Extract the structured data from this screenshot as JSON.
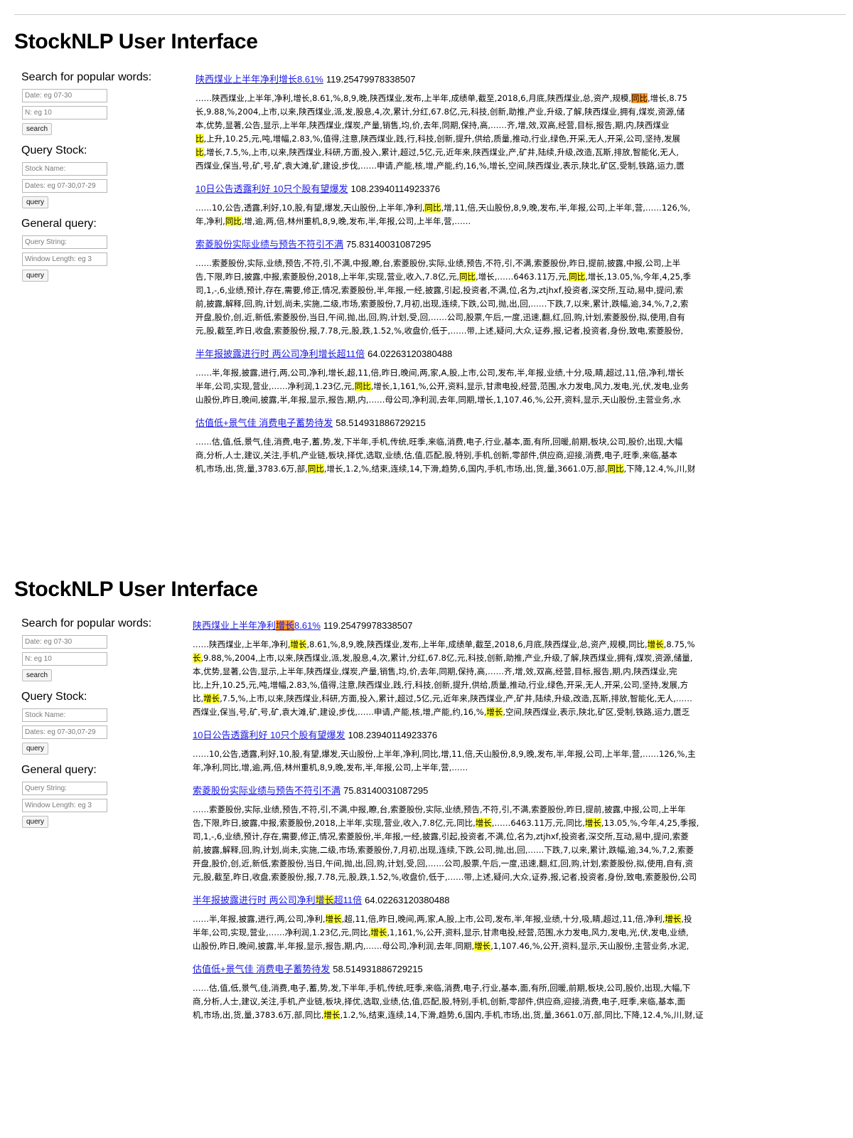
{
  "panels": [
    {
      "title": "StockNLP User Interface",
      "sidebar": {
        "popular": {
          "label": "Search for popular words:",
          "date_placeholder": "Date: eg 07-30",
          "n_placeholder": "N: eg 10",
          "button": "search"
        },
        "stock": {
          "label": "Query Stock:",
          "name_placeholder": "Stock Name:",
          "dates_placeholder": "Dates: eg 07-30,07-29",
          "button": "query"
        },
        "general": {
          "label": "General query:",
          "query_placeholder": "Query String:",
          "window_placeholder": "Window Length: eg 3",
          "button": "query"
        }
      },
      "highlight_color": "#ffff2e",
      "results": [
        {
          "title_parts": [
            {
              "t": "陕西煤业上半年净利增长8.61%",
              "h": ""
            }
          ],
          "score": "119.25479978338507",
          "lines": [
            [
              {
                "t": "……陕西煤业,上半年,净利,增长,8.61,%,8,9,晚,陕西煤业,发布,上半年,成绩单,截至,2018,6,月底,陕西煤业,总,资产,规模,",
                "h": ""
              },
              {
                "t": "同比",
                "h": "o"
              },
              {
                "t": ",增长,8.75",
                "h": ""
              }
            ],
            [
              {
                "t": "长,9.88,%,2004,上市,以来,陕西煤业,派,发,股息,4,次,累计,分红,67.8亿,元,科技,创新,助推,产业,升级,了解,陕西煤业,拥有,煤炭,资源,储",
                "h": ""
              }
            ],
            [
              {
                "t": "本,优势,显著,公告,显示,上半年,陕西煤业,煤炭,产量,销售,均,价,去年,同期,保持,高,……齐,增,效,双高,经营,目标,报告,期,内,陕西煤业",
                "h": ""
              }
            ],
            [
              {
                "t": "比",
                "h": "y"
              },
              {
                "t": ",上升,10.25,元,吨,增幅,2.83,%,值得,注意,陕西煤业,践,行,科技,创新,提升,供给,质量,推动,行业,绿色,开采,无人,开采,公司,坚持,发展",
                "h": ""
              }
            ],
            [
              {
                "t": "比",
                "h": "y"
              },
              {
                "t": ",增长,7.5,%,上市,以来,陕西煤业,科研,方面,投入,累计,超过,5亿,元,近年来,陕西煤业,产,矿井,陆续,升级,改造,瓦斯,排放,智能化,无人,",
                "h": ""
              }
            ],
            [
              {
                "t": "西煤业,保当,号,矿,号,矿,袁大滩,矿,建设,步伐,……申请,产能,核,增,产能,约,16,%,增长,空间,陕西煤业,表示,陕北,矿区,受制,铁路,运力,匮",
                "h": ""
              }
            ]
          ]
        },
        {
          "title_parts": [
            {
              "t": "10日公告透露利好 10只个股有望爆发",
              "h": ""
            }
          ],
          "score": "108.23940114923376",
          "lines": [
            [
              {
                "t": "……10,公告,透露,利好,10,股,有望,爆发,天山股份,上半年,净利,",
                "h": ""
              },
              {
                "t": "同比",
                "h": "y"
              },
              {
                "t": ",增,11,倍,天山股份,8,9,晚,发布,半,年报,公司,上半年,营,……126,%,",
                "h": ""
              }
            ],
            [
              {
                "t": "年,净利,",
                "h": ""
              },
              {
                "t": "同比",
                "h": "y"
              },
              {
                "t": ",增,逾,两,倍,林州重机,8,9,晚,发布,半,年报,公司,上半年,营,……",
                "h": ""
              }
            ]
          ]
        },
        {
          "title_parts": [
            {
              "t": "索菱股份实际业绩与预告不符引不满",
              "h": ""
            }
          ],
          "score": "75.83140031087295",
          "lines": [
            [
              {
                "t": "……索菱股份,实际,业绩,预告,不符,引,不满,中报,瞭,台,索菱股份,实际,业绩,预告,不符,引,不满,索菱股份,昨日,提前,披露,中报,公司,上半",
                "h": ""
              }
            ],
            [
              {
                "t": "告,下限,昨日,披露,中报,索菱股份,2018,上半年,实现,营业,收入,7.8亿,元,",
                "h": ""
              },
              {
                "t": "同比",
                "h": "y"
              },
              {
                "t": ",增长,……6463.11万,元,",
                "h": ""
              },
              {
                "t": "同比",
                "h": "y"
              },
              {
                "t": ",增长,13.05,%,今年,4,25,季",
                "h": ""
              }
            ],
            [
              {
                "t": "司,1,-,6,业绩,预计,存在,需要,修正,情况,索菱股份,半,年报,一经,披露,引起,投资者,不满,位,名为,ztjhxf,投资者,深交所,互动,易中,提问,索",
                "h": ""
              }
            ],
            [
              {
                "t": "前,披露,解释,回,购,计划,尚未,实施,二级,市场,索菱股份,7,月初,出现,连续,下跌,公司,抛,出,回,……下跌,7,以来,累计,跌幅,逾,34,%,7,2,索",
                "h": ""
              }
            ],
            [
              {
                "t": "开盘,股价,创,近,新低,索菱股份,当日,午间,抛,出,回,购,计划,受,回,……公司,股票,午后,一度,迅速,翻,红,回,购,计划,索菱股份,拟,使用,自有",
                "h": ""
              }
            ],
            [
              {
                "t": "元,股,截至,昨日,收盘,索菱股份,报,7.78,元,股,跌,1.52,%,收盘价,低于,……带,上述,疑问,大众,证券,报,记者,投资者,身份,致电,索菱股份,",
                "h": ""
              }
            ]
          ]
        },
        {
          "title_parts": [
            {
              "t": "半年报披露进行时 两公司净利增长超11倍",
              "h": ""
            }
          ],
          "score": "64.02263120380488",
          "lines": [
            [
              {
                "t": "……半,年报,披露,进行,两,公司,净利,增长,超,11,倍,昨日,晚间,两,家,A,股,上市,公司,发布,半,年报,业绩,十分,吸,睛,超过,11,倍,净利,增长",
                "h": ""
              }
            ],
            [
              {
                "t": "半年,公司,实现,营业,……净利润,1.23亿,元,",
                "h": ""
              },
              {
                "t": "同比",
                "h": "y"
              },
              {
                "t": ",增长,1,161,%,公开,资料,显示,甘肃电投,经营,范围,水力发电,风力,发电,光,伏,发电,业务",
                "h": ""
              }
            ],
            [
              {
                "t": "山股份,昨日,晚间,披露,半,年报,显示,报告,期,内,……母公司,净利润,去年,同期,增长,1,107.46,%,公开,资料,显示,天山股份,主营业务,水",
                "h": ""
              }
            ]
          ]
        },
        {
          "title_parts": [
            {
              "t": "估值低+景气佳 消费电子蓄势待发",
              "h": ""
            }
          ],
          "score": "58.514931886729215",
          "lines": [
            [
              {
                "t": "……估,值,低,景气,佳,消费,电子,蓄,势,发,下半年,手机,传统,旺季,来临,消费,电子,行业,基本,面,有所,回暖,前期,板块,公司,股价,出现,大幅",
                "h": ""
              }
            ],
            [
              {
                "t": "商,分析,人士,建议,关注,手机,产业链,板块,择优,选取,业绩,估,值,匹配,股,特别,手机,创新,零部件,供应商,迎接,消费,电子,旺季,来临,基本",
                "h": ""
              }
            ],
            [
              {
                "t": "机,市场,出,货,量,3783.6万,部,",
                "h": ""
              },
              {
                "t": "同比",
                "h": "y"
              },
              {
                "t": ",增长,1.2,%,结束,连续,14,下滑,趋势,6,国内,手机,市场,出,货,量,3661.0万,部,",
                "h": ""
              },
              {
                "t": "同比",
                "h": "y"
              },
              {
                "t": ",下降,12.4,%,川,财",
                "h": ""
              }
            ]
          ]
        }
      ]
    },
    {
      "title": "StockNLP User Interface",
      "sidebar": {
        "popular": {
          "label": "Search for popular words:",
          "date_placeholder": "Date: eg 07-30",
          "n_placeholder": "N: eg 10",
          "button": "search"
        },
        "stock": {
          "label": "Query Stock:",
          "name_placeholder": "Stock Name:",
          "dates_placeholder": "Dates: eg 07-30,07-29",
          "button": "query"
        },
        "general": {
          "label": "General query:",
          "query_placeholder": "Query String:",
          "window_placeholder": "Window Length: eg 3",
          "button": "query"
        }
      },
      "highlight_color": "#ffff2e",
      "results": [
        {
          "title_parts": [
            {
              "t": "陕西煤业上半年净利",
              "h": ""
            },
            {
              "t": "增长",
              "h": "o"
            },
            {
              "t": "8.61%",
              "h": ""
            }
          ],
          "score": "119.25479978338507",
          "lines": [
            [
              {
                "t": "……陕西煤业,上半年,净利,",
                "h": ""
              },
              {
                "t": "增长",
                "h": "y"
              },
              {
                "t": ",8.61,%,8,9,晚,陕西煤业,发布,上半年,成绩单,截至,2018,6,月底,陕西煤业,总,资产,规模,同比,",
                "h": ""
              },
              {
                "t": "增长",
                "h": "y"
              },
              {
                "t": ",8.75,%",
                "h": ""
              }
            ],
            [
              {
                "t": "长",
                "h": "y"
              },
              {
                "t": ",9.88,%,2004,上市,以来,陕西煤业,派,发,股息,4,次,累计,分红,67.8亿,元,科技,创新,助推,产业,升级,了解,陕西煤业,拥有,煤炭,资源,储量,",
                "h": ""
              }
            ],
            [
              {
                "t": "本,优势,显著,公告,显示,上半年,陕西煤业,煤炭,产量,销售,均,价,去年,同期,保持,高,……齐,增,效,双高,经营,目标,报告,期,内,陕西煤业,完",
                "h": ""
              }
            ],
            [
              {
                "t": "比,上升,10.25,元,吨,增幅,2.83,%,值得,注意,陕西煤业,践,行,科技,创新,提升,供给,质量,推动,行业,绿色,开采,无人,开采,公司,坚持,发展,方",
                "h": ""
              }
            ],
            [
              {
                "t": "比,",
                "h": ""
              },
              {
                "t": "增长",
                "h": "y"
              },
              {
                "t": ",7.5,%,上市,以来,陕西煤业,科研,方面,投入,累计,超过,5亿,元,近年来,陕西煤业,产,矿井,陆续,升级,改造,瓦斯,排放,智能化,无人,……",
                "h": ""
              }
            ],
            [
              {
                "t": "西煤业,保当,号,矿,号,矿,袁大滩,矿,建设,步伐,……申请,产能,核,增,产能,约,16,%,",
                "h": ""
              },
              {
                "t": "增长",
                "h": "y"
              },
              {
                "t": ",空间,陕西煤业,表示,陕北,矿区,受制,铁路,运力,匮乏",
                "h": ""
              }
            ]
          ]
        },
        {
          "title_parts": [
            {
              "t": "10日公告透露利好 10只个股有望爆发",
              "h": ""
            }
          ],
          "score": "108.23940114923376",
          "lines": [
            [
              {
                "t": "……10,公告,透露,利好,10,股,有望,爆发,天山股份,上半年,净利,同比,增,11,倍,天山股份,8,9,晚,发布,半,年报,公司,上半年,营,……126,%,主",
                "h": ""
              }
            ],
            [
              {
                "t": "年,净利,同比,增,逾,两,倍,林州重机,8,9,晚,发布,半,年报,公司,上半年,营,……",
                "h": ""
              }
            ]
          ]
        },
        {
          "title_parts": [
            {
              "t": "索菱股份实际业绩与预告不符引不满",
              "h": ""
            }
          ],
          "score": "75.83140031087295",
          "lines": [
            [
              {
                "t": "……索菱股份,实际,业绩,预告,不符,引,不满,中报,瞭,台,索菱股份,实际,业绩,预告,不符,引,不满,索菱股份,昨日,提前,披露,中报,公司,上半年",
                "h": ""
              }
            ],
            [
              {
                "t": "告,下限,昨日,披露,中报,索菱股份,2018,上半年,实现,营业,收入,7.8亿,元,同比,",
                "h": ""
              },
              {
                "t": "增长",
                "h": "y"
              },
              {
                "t": ",……6463.11万,元,同比,",
                "h": ""
              },
              {
                "t": "增长",
                "h": "y"
              },
              {
                "t": ",13.05,%,今年,4,25,季报,",
                "h": ""
              }
            ],
            [
              {
                "t": "司,1,-,6,业绩,预计,存在,需要,修正,情况,索菱股份,半,年报,一经,披露,引起,投资者,不满,位,名为,ztjhxf,投资者,深交所,互动,易中,提问,索菱",
                "h": ""
              }
            ],
            [
              {
                "t": "前,披露,解释,回,购,计划,尚未,实施,二级,市场,索菱股份,7,月初,出现,连续,下跌,公司,抛,出,回,……下跌,7,以来,累计,跌幅,逾,34,%,7,2,索菱",
                "h": ""
              }
            ],
            [
              {
                "t": "开盘,股价,创,近,新低,索菱股份,当日,午间,抛,出,回,购,计划,受,回,……公司,股票,午后,一度,迅速,翻,红,回,购,计划,索菱股份,拟,使用,自有,资",
                "h": ""
              }
            ],
            [
              {
                "t": "元,股,截至,昨日,收盘,索菱股份,报,7.78,元,股,跌,1.52,%,收盘价,低于,……带,上述,疑问,大众,证券,报,记者,投资者,身份,致电,索菱股份,公司",
                "h": ""
              }
            ]
          ]
        },
        {
          "title_parts": [
            {
              "t": "半年报披露进行时 两公司净利",
              "h": ""
            },
            {
              "t": "增长",
              "h": "y"
            },
            {
              "t": "超11倍",
              "h": ""
            }
          ],
          "score": "64.02263120380488",
          "lines": [
            [
              {
                "t": "……半,年报,披露,进行,两,公司,净利,",
                "h": ""
              },
              {
                "t": "增长",
                "h": "y"
              },
              {
                "t": ",超,11,倍,昨日,晚间,两,家,A,股,上市,公司,发布,半,年报,业绩,十分,吸,睛,超过,11,倍,净利,",
                "h": ""
              },
              {
                "t": "增长",
                "h": "y"
              },
              {
                "t": ",投",
                "h": ""
              }
            ],
            [
              {
                "t": "半年,公司,实现,营业,……净利润,1.23亿,元,同比,",
                "h": ""
              },
              {
                "t": "增长",
                "h": "y"
              },
              {
                "t": ",1,161,%,公开,资料,显示,甘肃电投,经营,范围,水力发电,风力,发电,光,伏,发电,业绩,",
                "h": ""
              }
            ],
            [
              {
                "t": "山股份,昨日,晚间,披露,半,年报,显示,报告,期,内,……母公司,净利润,去年,同期,",
                "h": ""
              },
              {
                "t": "增长",
                "h": "y"
              },
              {
                "t": ",1,107.46,%,公开,资料,显示,天山股份,主营业务,水泥,",
                "h": ""
              }
            ]
          ]
        },
        {
          "title_parts": [
            {
              "t": "估值低+景气佳 消费电子蓄势待发",
              "h": ""
            }
          ],
          "score": "58.514931886729215",
          "lines": [
            [
              {
                "t": "……估,值,低,景气,佳,消费,电子,蓄,势,发,下半年,手机,传统,旺季,来临,消费,电子,行业,基本,面,有所,回暖,前期,板块,公司,股价,出现,大幅,下",
                "h": ""
              }
            ],
            [
              {
                "t": "商,分析,人士,建议,关注,手机,产业链,板块,择优,选取,业绩,估,值,匹配,股,特别,手机,创新,零部件,供应商,迎接,消费,电子,旺季,来临,基本,面",
                "h": ""
              }
            ],
            [
              {
                "t": "机,市场,出,货,量,3783.6万,部,同比,",
                "h": ""
              },
              {
                "t": "增长",
                "h": "y"
              },
              {
                "t": ",1.2,%,结束,连续,14,下滑,趋势,6,国内,手机,市场,出,货,量,3661.0万,部,同比,下降,12.4,%,川,财,证",
                "h": ""
              }
            ]
          ]
        }
      ]
    }
  ]
}
